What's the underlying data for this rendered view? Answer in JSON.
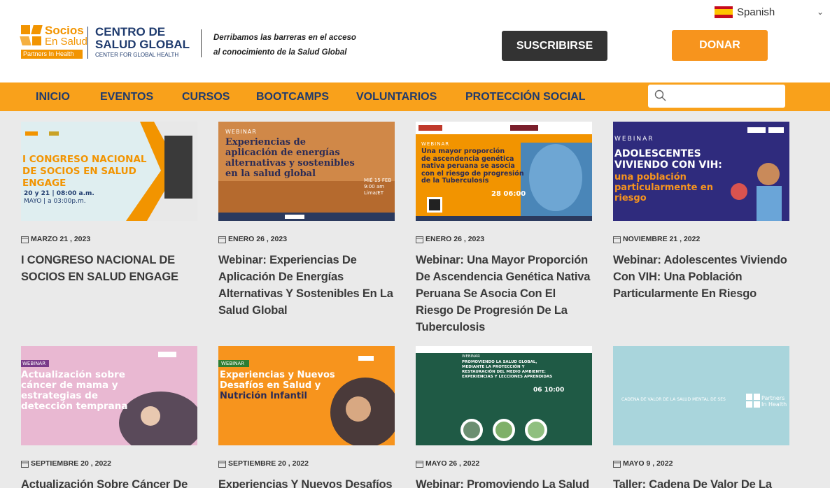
{
  "language": {
    "label": "Spanish"
  },
  "logo": {
    "socios": "Socios",
    "en_salud": "En Salud",
    "partners": "Partners In Health",
    "centro_line1": "CENTRO DE",
    "centro_line2": "SALUD GLOBAL",
    "center_en": "CENTER FOR GLOBAL HEALTH"
  },
  "tagline": {
    "line1": "Derribamos las barreras en el acceso",
    "line2": "al conocimiento de la Salud Global"
  },
  "buttons": {
    "subscribe": "SUSCRIBIRSE",
    "donate": "DONAR"
  },
  "nav": [
    "INICIO",
    "EVENTOS",
    "CURSOS",
    "BOOTCAMPS",
    "VOLUNTARIOS",
    "PROTECCIÓN SOCIAL"
  ],
  "search": {
    "placeholder": ""
  },
  "colors": {
    "accent": "#f9a11b",
    "navy": "#1f3b6e",
    "dark_button": "#333333"
  },
  "cards": [
    {
      "date": "MARZO 21 , 2023",
      "title": "I CONGRESO NACIONAL DE SOCIOS EN SALUD ENGAGE",
      "thumb": {
        "lines": [
          "I CONGRESO NACIONAL",
          "DE SOCIOS EN SALUD",
          "ENGAGE"
        ],
        "sub1": "20 y 21 | 08:00 a.m.",
        "sub2": "MAYO | a 03:00p.m."
      }
    },
    {
      "date": "ENERO 26 , 2023",
      "title": "Webinar: Experiencias De Aplicación De Energías Alternativas Y Sostenibles En La Salud Global",
      "thumb": {
        "tag": "WEBINAR",
        "lines": [
          "Experiencias de",
          "aplicación de energías",
          "alternativas y sostenibles",
          "en la salud global"
        ],
        "sub1": "MIÉ 15 FEB",
        "sub2": "9:00 am",
        "sub3": "Lima/ET"
      }
    },
    {
      "date": "ENERO 26 , 2023",
      "title": "Webinar: Una Mayor Proporción De Ascendencia Genética Nativa Peruana Se Asocia Con El Riesgo De Progresión De La Tuberculosis",
      "thumb": {
        "tag": "WEBINAR",
        "lines": [
          "Una mayor proporción",
          "de ascendencia genética",
          "nativa peruana se asocia",
          "con el riesgo de progresión",
          "de la Tuberculosis"
        ],
        "sub1": "28 06:00"
      }
    },
    {
      "date": "NOVIEMBRE 21 , 2022",
      "title": "Webinar: Adolescentes Viviendo Con VIH: Una Población Particularmente En Riesgo",
      "thumb": {
        "tag": "WEBINAR",
        "lines": [
          "ADOLESCENTES",
          "VIVIENDO CON VIH:"
        ],
        "lines2": [
          "una población",
          "particularmente en",
          "riesgo"
        ]
      }
    },
    {
      "date": "SEPTIEMBRE 20 , 2022",
      "title": "Actualización Sobre Cáncer De",
      "thumb": {
        "tag": "WEBINAR",
        "lines": [
          "Actualización sobre",
          "cáncer de mama y",
          "estrategias de",
          "detección temprana"
        ]
      }
    },
    {
      "date": "SEPTIEMBRE 20 , 2022",
      "title": "Experiencias Y Nuevos Desafíos En",
      "thumb": {
        "tag": "WEBINAR",
        "lines": [
          "Experiencias y Nuevos",
          "Desafíos en Salud y",
          "Nutrición Infantil"
        ]
      }
    },
    {
      "date": "MAYO 26 , 2022",
      "title": "Webinar: Promoviendo La Salud",
      "thumb": {
        "tag": "WEBINAR",
        "lines": [
          "PROMOVIENDO LA SALUD GLOBAL,",
          "MEDIANTE LA PROTECCIÓN Y",
          "RESTAURACIÓN DEL MEDIO AMBIENTE:",
          "EXPERIENCIAS Y LECCIONES APRENDIDAS"
        ],
        "sub1": "06 10:00"
      }
    },
    {
      "date": "MAYO 9 , 2022",
      "title": "Taller: Cadena De Valor De La",
      "thumb": {
        "lines": [
          "CADENA DE VALOR DE LA SALUD MENTAL DE SES"
        ],
        "brand": "Partners In Health"
      }
    }
  ]
}
